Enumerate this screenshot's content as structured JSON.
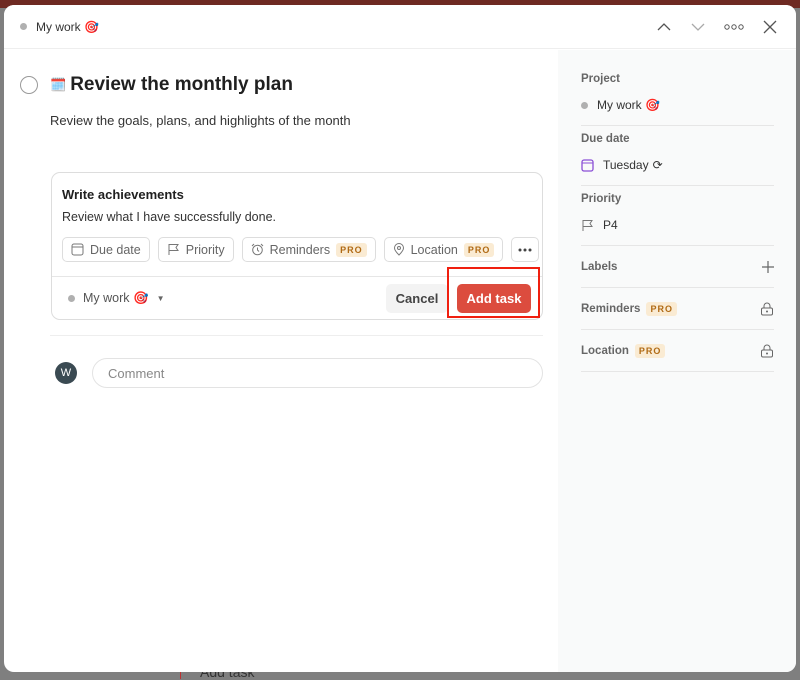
{
  "header": {
    "project": "My work 🎯"
  },
  "task": {
    "title": "Review the monthly plan",
    "title_emoji": "🗓️",
    "description": "Review the goals, plans, and highlights of the month"
  },
  "subtask_editor": {
    "name": "Write achievements",
    "description": "Review what I have successfully done.",
    "chips": {
      "due_date": "Due date",
      "priority": "Priority",
      "reminders": "Reminders",
      "location": "Location",
      "pro": "PRO"
    },
    "project": "My work 🎯",
    "cancel": "Cancel",
    "add_task": "Add task"
  },
  "comment": {
    "avatar": "W",
    "placeholder": "Comment"
  },
  "sidebar": {
    "project_label": "Project",
    "project_value": "My work 🎯",
    "due_label": "Due date",
    "due_value": "Tuesday",
    "priority_label": "Priority",
    "priority_value": "P4",
    "labels_label": "Labels",
    "reminders_label": "Reminders",
    "location_label": "Location",
    "pro": "PRO"
  },
  "background": {
    "behind_text": "Add task"
  },
  "colors": {
    "accent": "#dc4c3e",
    "pro_bg": "#faebd3",
    "pro_text": "#b06a14",
    "due_icon": "#8a4fd6"
  }
}
